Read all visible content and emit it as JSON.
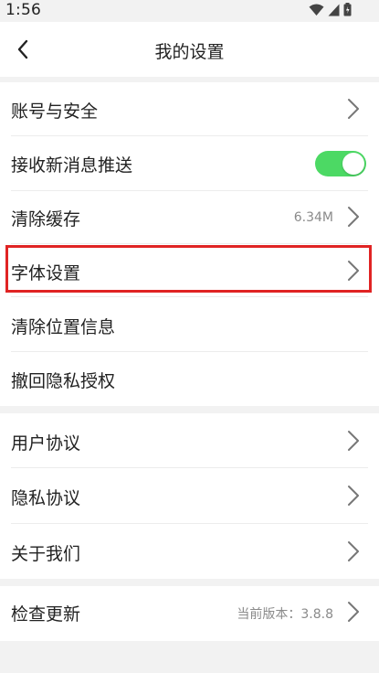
{
  "status_bar": {
    "time": "1:56",
    "icons": [
      "wifi-icon",
      "signal-icon",
      "battery-icon"
    ]
  },
  "header": {
    "back_icon": "chevron-left-icon",
    "title": "我的设置"
  },
  "groups": [
    {
      "items": [
        {
          "label": "账号与安全",
          "control": "chevron"
        },
        {
          "label": "接收新消息推送",
          "control": "toggle",
          "toggle_on": true
        },
        {
          "label": "清除缓存",
          "control": "chevron",
          "value": "6.34M"
        },
        {
          "label": "字体设置",
          "control": "chevron",
          "highlighted": true
        },
        {
          "label": "清除位置信息",
          "control": "none"
        },
        {
          "label": "撤回隐私授权",
          "control": "none"
        }
      ]
    },
    {
      "items": [
        {
          "label": "用户协议",
          "control": "chevron"
        },
        {
          "label": "隐私协议",
          "control": "chevron"
        },
        {
          "label": "关于我们",
          "control": "chevron"
        }
      ]
    },
    {
      "items": [
        {
          "label": "检查更新",
          "control": "chevron",
          "value": "当前版本：3.8.8"
        }
      ]
    }
  ],
  "colors": {
    "toggle_on": "#4cd964",
    "highlight": "#e02424",
    "background": "#f2f2f2"
  }
}
